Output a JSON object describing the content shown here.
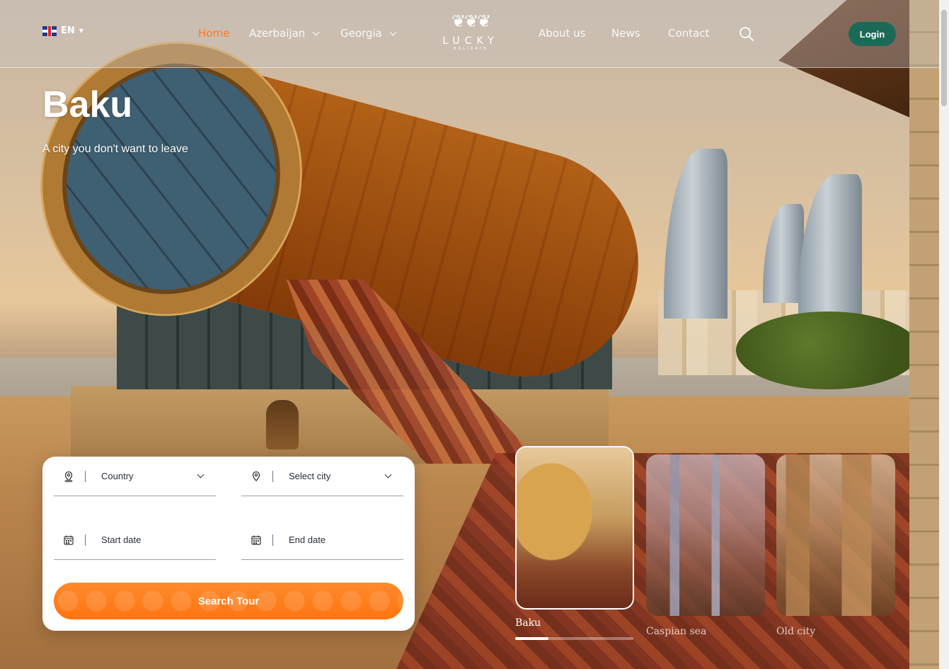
{
  "header": {
    "language": "EN",
    "nav": [
      {
        "label": "Home",
        "active": true
      },
      {
        "label": "Azerbaijan",
        "dropdown": true
      },
      {
        "label": "Georgia",
        "dropdown": true
      },
      {
        "label": "About us"
      },
      {
        "label": "News"
      },
      {
        "label": "Contact"
      }
    ],
    "logo": {
      "name": "LUCKY",
      "sub": "HOLIDAYS"
    },
    "login_label": "Login"
  },
  "hero": {
    "title": "Baku",
    "subtitle": "A city you don't want to leave"
  },
  "search_form": {
    "country_label": "Country",
    "city_label": "Select city",
    "start_label": "Start date",
    "end_label": "End date",
    "button_label": "Search Tour"
  },
  "destinations": [
    {
      "label": "Baku",
      "active": true
    },
    {
      "label": "Caspian sea",
      "active": false
    },
    {
      "label": "Old city",
      "active": false
    }
  ],
  "slider_progress": 0.28,
  "colors": {
    "accent": "#ff7a1a",
    "login": "#1b6a57"
  }
}
